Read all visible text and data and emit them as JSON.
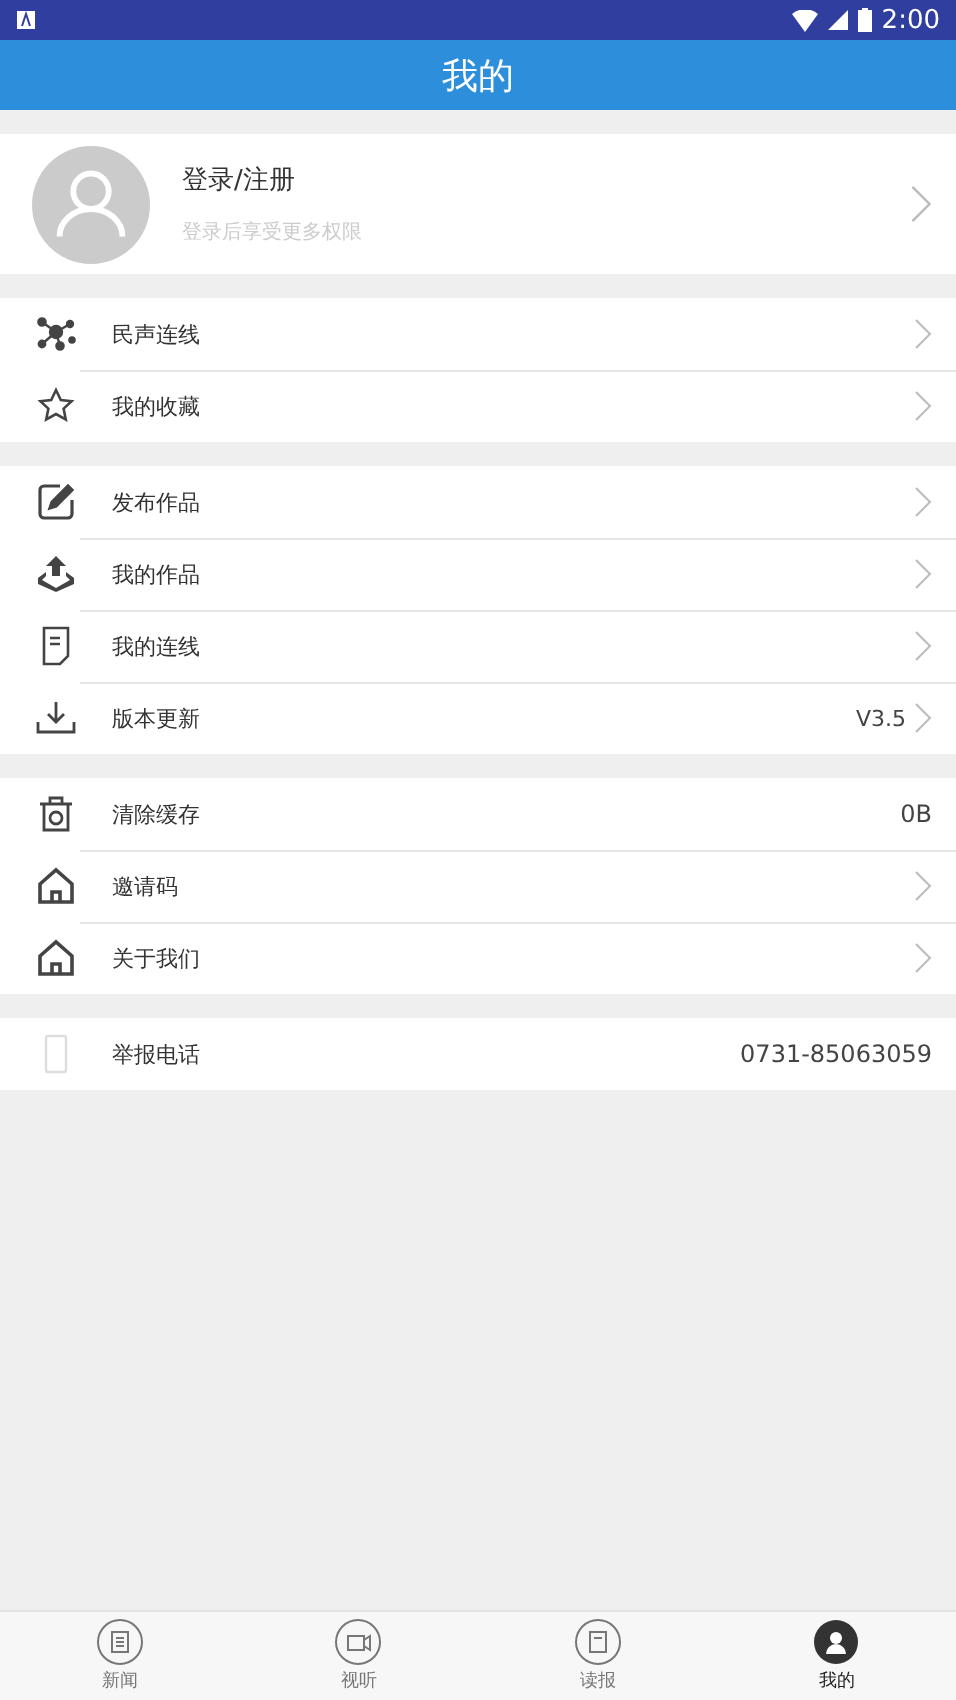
{
  "status_bar": {
    "time": "2:00"
  },
  "header": {
    "title": "我的"
  },
  "profile": {
    "name": "登录/注册",
    "hint": "登录后享受更多权限"
  },
  "groups": [
    {
      "items": [
        {
          "label": "民声连线",
          "arrow": true
        },
        {
          "label": "我的收藏",
          "arrow": true
        }
      ]
    },
    {
      "items": [
        {
          "label": "发布作品",
          "arrow": true
        },
        {
          "label": "我的作品",
          "arrow": true
        },
        {
          "label": "我的连线",
          "arrow": true
        },
        {
          "label": "版本更新",
          "value": "V3.5",
          "arrow": true
        }
      ]
    },
    {
      "items": [
        {
          "label": "清除缓存",
          "value": "0B",
          "arrow": false
        },
        {
          "label": "邀请码",
          "arrow": true
        },
        {
          "label": "关于我们",
          "arrow": true
        }
      ]
    },
    {
      "items": [
        {
          "label": "举报电话",
          "value": "0731-85063059",
          "arrow": false
        }
      ]
    }
  ],
  "tabs": [
    {
      "label": "新闻",
      "selected": false
    },
    {
      "label": "视听",
      "selected": false
    },
    {
      "label": "读报",
      "selected": false
    },
    {
      "label": "我的",
      "selected": true
    }
  ]
}
